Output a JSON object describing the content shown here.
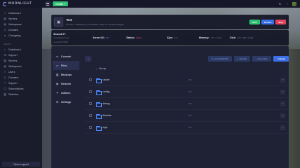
{
  "brand": {
    "name": "MOONLIGHT"
  },
  "topbar": {
    "create_label": "Create +",
    "icons": [
      "sync-icon",
      "avatar"
    ]
  },
  "sidebar": {
    "items": [
      {
        "label": "Dashboard",
        "icon": "home-icon"
      },
      {
        "label": "Servers",
        "icon": "server-icon"
      },
      {
        "label": "Webspaces",
        "icon": "globe-icon"
      },
      {
        "label": "Domains",
        "icon": "domain-icon"
      },
      {
        "label": "Changelog",
        "icon": "log-icon"
      }
    ],
    "admin_section": "ADMIN",
    "admin_items": [
      {
        "label": "Dashboard",
        "icon": "home-icon"
      },
      {
        "label": "Support",
        "icon": "support-icon"
      },
      {
        "label": "Servers",
        "icon": "server-icon"
      },
      {
        "label": "Webspaces",
        "icon": "globe-icon"
      },
      {
        "label": "Users",
        "icon": "user-icon"
      },
      {
        "label": "Domains",
        "icon": "domain-icon"
      },
      {
        "label": "Support",
        "icon": "help-icon"
      },
      {
        "label": "Subscriptions",
        "icon": "subscription-icon"
      },
      {
        "label": "Statistics",
        "icon": "stats-icon"
      }
    ],
    "support_button": "Open support"
  },
  "server": {
    "name": "Test",
    "subtitle": "1 Cores / 1 GB Memory / 10 GB Disk / Paper 1 / Timelines Plugins",
    "actions": {
      "start": "Start",
      "restart": "Restart",
      "stop": "Stop"
    }
  },
  "info": {
    "shared_ip_label": "Shared IP:",
    "shared_ip_value": "moonlightservices",
    "shared_ip_value2": "moonlight:25565",
    "server_id_label": "Server ID:",
    "server_id_value": "727",
    "status_label": "Status:",
    "status_value": "Offline",
    "cpu_label": "Cpu:",
    "cpu_value": "0 %",
    "memory_label": "Memory:",
    "memory_value": "0 B / 1.0 GB",
    "disk_label": "Disk:",
    "disk_value": "223.7 MB / 10 GB"
  },
  "subnav": [
    {
      "label": "Console",
      "icon": "console-icon",
      "active": false
    },
    {
      "label": "Files",
      "icon": "folder-icon",
      "active": true
    },
    {
      "label": "Backups",
      "icon": "backup-icon",
      "active": false
    },
    {
      "label": "Network",
      "icon": "network-icon",
      "active": false
    },
    {
      "label": "Addons",
      "icon": "addon-icon",
      "active": false
    },
    {
      "label": "Settings",
      "icon": "settings-icon",
      "active": false
    }
  ],
  "files": {
    "toolbar": {
      "nav_label": "/",
      "launch_label": "Launch WinSCP",
      "new_file_label": "New file",
      "new_folder_label": "New folder",
      "upload_label": "Upload"
    },
    "go_up_label": "Go up",
    "rows": [
      {
        "name": "cache",
        "size": "0 B",
        "date": ""
      },
      {
        "name": "config",
        "size": "0 B",
        "date": ""
      },
      {
        "name": "debug",
        "size": "0 B",
        "date": ""
      },
      {
        "name": "libraries",
        "size": "0 B",
        "date": ""
      },
      {
        "name": "logs",
        "size": "0 B",
        "date": ""
      }
    ]
  },
  "colors": {
    "accent": "#3a6fe6",
    "start": "#2fbf73",
    "restart": "#3a6fe6",
    "stop": "#e0445d",
    "offline": "#e0445d"
  }
}
